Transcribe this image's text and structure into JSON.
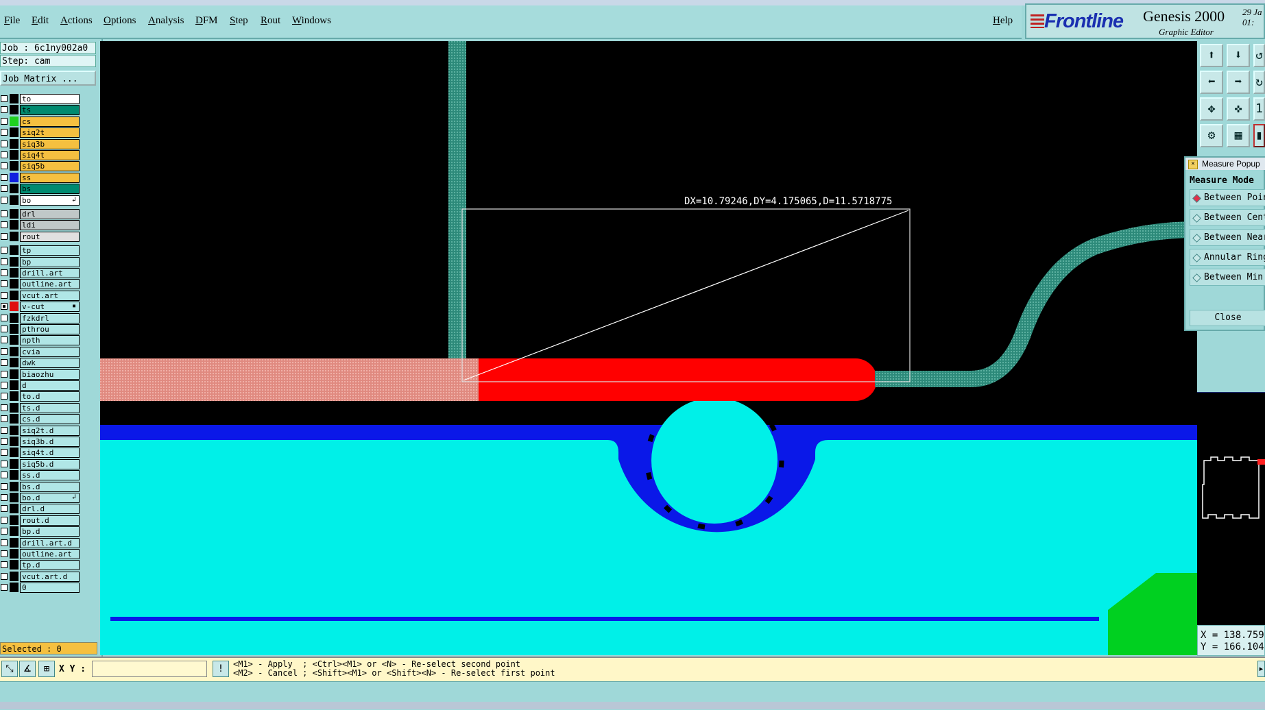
{
  "menu": {
    "items": [
      "File",
      "Edit",
      "Actions",
      "Options",
      "Analysis",
      "DFM",
      "Step",
      "Rout",
      "Windows"
    ],
    "help": "Help"
  },
  "brand": {
    "logo": "Frontline",
    "product": "Genesis 2000",
    "subtitle": "Graphic Editor",
    "date_line1": "29 Ja",
    "date_line2": "01:"
  },
  "job": {
    "job_label": "Job : 6c1ny002a0",
    "step_label": "Step: cam",
    "matrix_button": "Job Matrix ..."
  },
  "layers": [
    {
      "name": "to",
      "bg": "#ffffff",
      "swatch": "#000000",
      "checked": false
    },
    {
      "name": "ts",
      "bg": "#008a70",
      "swatch": "#000000",
      "checked": false
    },
    {
      "name": "cs",
      "bg": "#f5c040",
      "swatch": "#20d020",
      "checked": false
    },
    {
      "name": "siq2t",
      "bg": "#f5c040",
      "swatch": "#000000",
      "checked": false
    },
    {
      "name": "siq3b",
      "bg": "#f5c040",
      "swatch": "#000000",
      "checked": false
    },
    {
      "name": "siq4t",
      "bg": "#f5c040",
      "swatch": "#000000",
      "checked": false
    },
    {
      "name": "siq5b",
      "bg": "#f5c040",
      "swatch": "#000000",
      "checked": false
    },
    {
      "name": "ss",
      "bg": "#f5c040",
      "swatch": "#1020e0",
      "checked": false
    },
    {
      "name": "bs",
      "bg": "#008a70",
      "swatch": "#000000",
      "checked": false
    },
    {
      "name": "bo",
      "bg": "#ffffff",
      "swatch": "#000000",
      "checked": false,
      "mark": "↲"
    },
    {
      "name": "drl",
      "bg": "#c0c8c8",
      "swatch": "#000000",
      "checked": false
    },
    {
      "name": "ldi",
      "bg": "#c0c8c8",
      "swatch": "#000000",
      "checked": false
    },
    {
      "name": "rout",
      "bg": "#e0e0e0",
      "swatch": "#000000",
      "checked": false
    },
    {
      "name": "tp",
      "bg": "#b0e6e6",
      "swatch": "#000000",
      "checked": false
    },
    {
      "name": "bp",
      "bg": "#b0e6e6",
      "swatch": "#000000",
      "checked": false
    },
    {
      "name": "drill.art",
      "bg": "#b0e6e6",
      "swatch": "#000000",
      "checked": false
    },
    {
      "name": "outline.art",
      "bg": "#b0e6e6",
      "swatch": "#000000",
      "checked": false
    },
    {
      "name": "vcut.art",
      "bg": "#b0e6e6",
      "swatch": "#000000",
      "checked": false
    },
    {
      "name": "v-cut",
      "bg": "#b0e6e6",
      "swatch": "#e01010",
      "checked": true,
      "mark": "▪"
    },
    {
      "name": "fzkdrl",
      "bg": "#b0e6e6",
      "swatch": "#000000",
      "checked": false
    },
    {
      "name": "pthrou",
      "bg": "#b0e6e6",
      "swatch": "#000000",
      "checked": false
    },
    {
      "name": "npth",
      "bg": "#b0e6e6",
      "swatch": "#000000",
      "checked": false
    },
    {
      "name": "cvia",
      "bg": "#b0e6e6",
      "swatch": "#000000",
      "checked": false
    },
    {
      "name": "dwk",
      "bg": "#b0e6e6",
      "swatch": "#000000",
      "checked": false
    },
    {
      "name": "biaozhu",
      "bg": "#b0e6e6",
      "swatch": "#000000",
      "checked": false
    },
    {
      "name": "d",
      "bg": "#b0e6e6",
      "swatch": "#000000",
      "checked": false
    },
    {
      "name": "to.d",
      "bg": "#b0e6e6",
      "swatch": "#000000",
      "checked": false
    },
    {
      "name": "ts.d",
      "bg": "#b0e6e6",
      "swatch": "#000000",
      "checked": false
    },
    {
      "name": "cs.d",
      "bg": "#b0e6e6",
      "swatch": "#000000",
      "checked": false
    },
    {
      "name": "siq2t.d",
      "bg": "#b0e6e6",
      "swatch": "#000000",
      "checked": false
    },
    {
      "name": "siq3b.d",
      "bg": "#b0e6e6",
      "swatch": "#000000",
      "checked": false
    },
    {
      "name": "siq4t.d",
      "bg": "#b0e6e6",
      "swatch": "#000000",
      "checked": false
    },
    {
      "name": "siq5b.d",
      "bg": "#b0e6e6",
      "swatch": "#000000",
      "checked": false
    },
    {
      "name": "ss.d",
      "bg": "#b0e6e6",
      "swatch": "#000000",
      "checked": false
    },
    {
      "name": "bs.d",
      "bg": "#b0e6e6",
      "swatch": "#000000",
      "checked": false
    },
    {
      "name": "bo.d",
      "bg": "#b0e6e6",
      "swatch": "#000000",
      "checked": false,
      "mark": "↲"
    },
    {
      "name": "drl.d",
      "bg": "#b0e6e6",
      "swatch": "#000000",
      "checked": false
    },
    {
      "name": "rout.d",
      "bg": "#b0e6e6",
      "swatch": "#000000",
      "checked": false
    },
    {
      "name": "bp.d",
      "bg": "#b0e6e6",
      "swatch": "#000000",
      "checked": false
    },
    {
      "name": "drill.art.d",
      "bg": "#b0e6e6",
      "swatch": "#000000",
      "checked": false
    },
    {
      "name": "outline.art",
      "bg": "#b0e6e6",
      "swatch": "#000000",
      "checked": false
    },
    {
      "name": "tp.d",
      "bg": "#b0e6e6",
      "swatch": "#000000",
      "checked": false
    },
    {
      "name": "vcut.art.d",
      "bg": "#b0e6e6",
      "swatch": "#000000",
      "checked": false
    },
    {
      "name": "0",
      "bg": "#b0e6e6",
      "swatch": "#000000",
      "checked": false
    }
  ],
  "selected_label": "Selected : 0",
  "canvas": {
    "measure_text": "DX=10.79246,DY=4.175065,D=11.5718775",
    "colors": {
      "background": "#000000",
      "trace": "#2d8a7a",
      "pad_pink": "#e08a80",
      "pad_red": "#ff0000",
      "plane": "#00f0e8",
      "plane_edge": "#0a18e8",
      "ring": "#0a18e8",
      "hole": "#00f0e8",
      "corner": "#00d020"
    }
  },
  "measure_popup": {
    "title": "Measure Popup",
    "header": "Measure Mode",
    "options": [
      "Between Points",
      "Between Centers",
      "Between Nearest",
      "Annular Ring",
      "Between Min"
    ],
    "selected_index": 0,
    "close": "Close"
  },
  "coords": {
    "x": "X = 138.759",
    "y": "Y = 166.104"
  },
  "status": {
    "xy_label": "X Y :",
    "xy_value": "",
    "info_icon": "!",
    "message_line1": "<M1> - Apply  ; <Ctrl><M1> or <N> - Re-select second point",
    "message_line2": "<M2> - Cancel ; <Shift><M1> or <Shift><N> - Re-select first point"
  },
  "toolbar_icons": [
    "zoom-home-icon",
    "zoom-down-icon",
    "zoom-left-icon",
    "zoom-right-icon",
    "zoom-fit-icon",
    "zoom-center-icon",
    "snap-icon",
    "grid-icon"
  ]
}
